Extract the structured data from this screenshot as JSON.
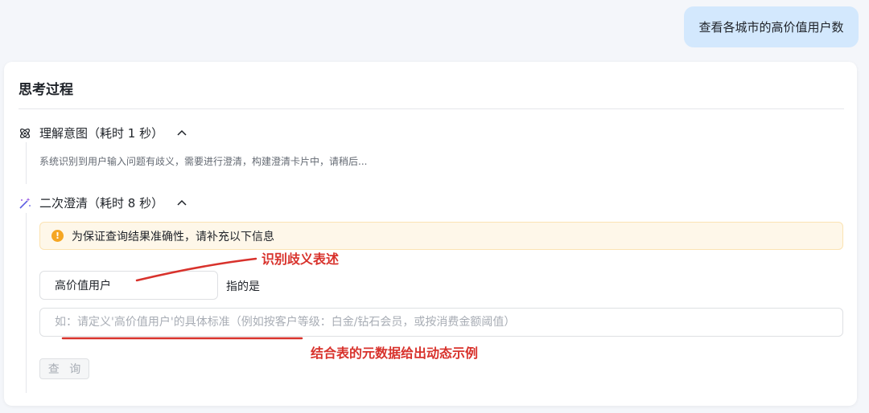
{
  "user_message": "查看各城市的高价值用户数",
  "thinking": {
    "title": "思考过程",
    "steps": [
      {
        "label": "理解意图（耗时 1 秒）",
        "description": "系统识别到用户输入问题有歧义，需要进行澄清，构建澄清卡片中，请稍后..."
      },
      {
        "label": "二次澄清（耗时 8 秒）"
      }
    ]
  },
  "clarify": {
    "notice": "为保证查询结果准确性，请补充以下信息",
    "term": "高价值用户",
    "refers_to": "指的是",
    "definition_placeholder": "如：请定义'高价值用户'的具体标准（例如按客户等级：白金/钻石会员，或按消费金额阈值）",
    "query_button": "查 询"
  },
  "annotations": {
    "ambiguity": "识别歧义表述",
    "metadata_example": "结合表的元数据给出动态示例"
  },
  "colors": {
    "accent_bubble": "#d3e8fd",
    "warning": "#f5a623",
    "annotation_red": "#d8322c"
  }
}
